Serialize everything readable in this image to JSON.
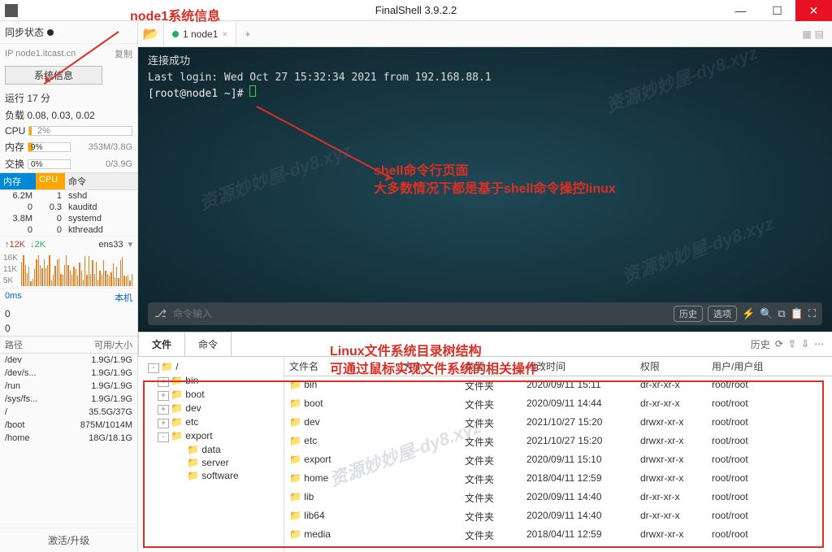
{
  "title": "FinalShell 3.9.2.2",
  "annotations": {
    "top": "node1系统信息",
    "mid1": "shell命令行页面",
    "mid2": "大多数情况下都是基于shell命令操控linux",
    "fs1": "Linux文件系统目录树结构",
    "fs2": "可通过鼠标实现文件系统的相关操作"
  },
  "sidebar": {
    "sync_label": "同步状态",
    "ip": "IP node1.itcast.cn",
    "copy": "复制",
    "sysinfo_btn": "系统信息",
    "uptime": "运行 17 分",
    "load": "负载 0.08, 0.03, 0.02",
    "cpu_label": "CPU",
    "cpu_pct": "2%",
    "mem_label": "内存",
    "mem_pct": "9%",
    "mem_detail": "353M/3.8G",
    "swap_label": "交换",
    "swap_pct": "0%",
    "swap_detail": "0/3.9G",
    "proc_cols": {
      "mem": "内存",
      "cpu": "CPU",
      "cmd": "命令"
    },
    "procs": [
      {
        "mem": "6.2M",
        "cpu": "1",
        "cmd": "sshd"
      },
      {
        "mem": "0",
        "cpu": "0.3",
        "cmd": "kauditd"
      },
      {
        "mem": "3.8M",
        "cpu": "0",
        "cmd": "systemd"
      },
      {
        "mem": "0",
        "cpu": "0",
        "cmd": "kthreadd"
      }
    ],
    "net_up": "↑12K",
    "net_down": "↓2K",
    "net_if": "ens33",
    "ytick1": "16K",
    "ytick2": "11K",
    "ytick3": "5K",
    "ping_ms": "0ms",
    "ping_host": "本机",
    "zero1": "0",
    "zero2": "0",
    "path_hdr": {
      "path": "路径",
      "size": "可用/大小"
    },
    "paths": [
      {
        "p": "/dev",
        "s": "1.9G/1.9G"
      },
      {
        "p": "/dev/s...",
        "s": "1.9G/1.9G"
      },
      {
        "p": "/run",
        "s": "1.9G/1.9G"
      },
      {
        "p": "/sys/fs...",
        "s": "1.9G/1.9G"
      },
      {
        "p": "/",
        "s": "35.5G/37G"
      },
      {
        "p": "/boot",
        "s": "875M/1014M"
      },
      {
        "p": "/home",
        "s": "18G/18.1G"
      }
    ],
    "activate": "激活/升级"
  },
  "tab": {
    "label": "1 node1"
  },
  "terminal": {
    "l1": "连接成功",
    "l2": "Last login: Wed Oct 27 15:32:34 2021 from 192.168.88.1",
    "prompt": "[root@node1 ~]# ",
    "input_placeholder": "命令输入",
    "history": "历史",
    "options": "选项"
  },
  "bottom_tabs": {
    "file": "文件",
    "cmd": "命令",
    "history_label": "历史"
  },
  "tree": {
    "root": "/",
    "nodes": [
      "bin",
      "boot",
      "dev",
      "etc",
      "export",
      "data",
      "server",
      "software"
    ]
  },
  "file_hdr": {
    "name": "文件名",
    "size": "大小",
    "type": "类型",
    "mod": "修改时间",
    "perm": "权限",
    "owner": "用户/用户组"
  },
  "files": [
    {
      "name": "bin",
      "type": "文件夹",
      "mod": "2020/09/11 15:11",
      "perm": "dr-xr-xr-x",
      "owner": "root/root"
    },
    {
      "name": "boot",
      "type": "文件夹",
      "mod": "2020/09/11 14:44",
      "perm": "dr-xr-xr-x",
      "owner": "root/root"
    },
    {
      "name": "dev",
      "type": "文件夹",
      "mod": "2021/10/27 15:20",
      "perm": "drwxr-xr-x",
      "owner": "root/root"
    },
    {
      "name": "etc",
      "type": "文件夹",
      "mod": "2021/10/27 15:20",
      "perm": "drwxr-xr-x",
      "owner": "root/root"
    },
    {
      "name": "export",
      "type": "文件夹",
      "mod": "2020/09/11 15:10",
      "perm": "drwxr-xr-x",
      "owner": "root/root"
    },
    {
      "name": "home",
      "type": "文件夹",
      "mod": "2018/04/11 12:59",
      "perm": "drwxr-xr-x",
      "owner": "root/root"
    },
    {
      "name": "lib",
      "type": "文件夹",
      "mod": "2020/09/11 14:40",
      "perm": "dr-xr-xr-x",
      "owner": "root/root"
    },
    {
      "name": "lib64",
      "type": "文件夹",
      "mod": "2020/09/11 14:40",
      "perm": "dr-xr-xr-x",
      "owner": "root/root"
    },
    {
      "name": "media",
      "type": "文件夹",
      "mod": "2018/04/11 12:59",
      "perm": "drwxr-xr-x",
      "owner": "root/root"
    }
  ],
  "watermark": "资源妙妙屋-dy8.xyz"
}
